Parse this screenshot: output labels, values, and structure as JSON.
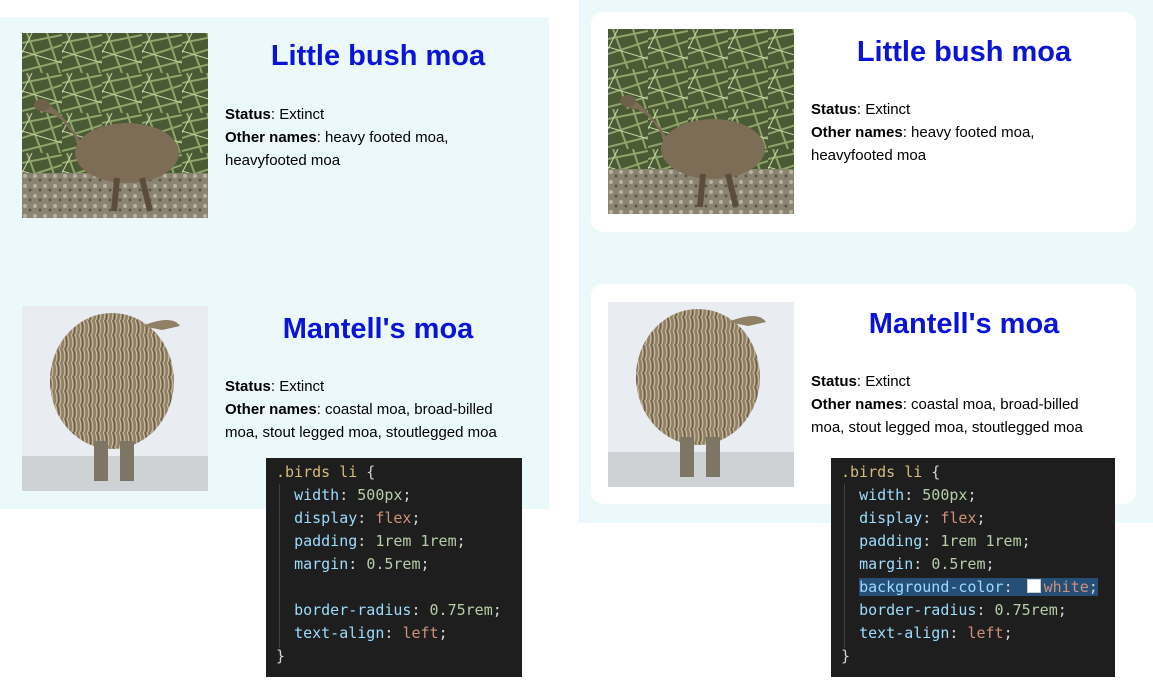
{
  "left": {
    "birds": [
      {
        "name": "Little bush moa",
        "status_label": "Status",
        "status": "Extinct",
        "other_label": "Other names",
        "other": "heavy footed moa, heavyfooted moa",
        "image": "little-bush-moa-illustration"
      },
      {
        "name": "Mantell's moa",
        "status_label": "Status",
        "status": "Extinct",
        "other_label": "Other names",
        "other": "coastal moa, broad-billed moa, stout legged moa, stoutlegged moa",
        "image": "mantells-moa-illustration"
      }
    ],
    "code": {
      "selector": ".birds li",
      "lines": [
        {
          "prop": "width",
          "value": "500px"
        },
        {
          "prop": "display",
          "value": "flex"
        },
        {
          "prop": "padding",
          "value": "1rem 1rem"
        },
        {
          "prop": "margin",
          "value": "0.5rem"
        },
        {
          "prop": "border-radius",
          "value": "0.75rem"
        },
        {
          "prop": "text-align",
          "value": "left"
        }
      ]
    }
  },
  "right": {
    "birds": [
      {
        "name": "Little bush moa",
        "status_label": "Status",
        "status": "Extinct",
        "other_label": "Other names",
        "other": "heavy footed moa, heavyfooted moa",
        "image": "little-bush-moa-illustration"
      },
      {
        "name": "Mantell's moa",
        "status_label": "Status",
        "status": "Extinct",
        "other_label": "Other names",
        "other": "coastal moa, broad-billed moa, stout legged moa, stoutlegged moa",
        "image": "mantells-moa-illustration"
      }
    ],
    "code": {
      "selector": ".birds li",
      "lines": [
        {
          "prop": "width",
          "value": "500px"
        },
        {
          "prop": "display",
          "value": "flex"
        },
        {
          "prop": "padding",
          "value": "1rem 1rem"
        },
        {
          "prop": "margin",
          "value": "0.5rem"
        },
        {
          "prop": "background-color",
          "value": "white",
          "highlighted": true
        },
        {
          "prop": "border-radius",
          "value": "0.75rem"
        },
        {
          "prop": "text-align",
          "value": "left"
        }
      ]
    }
  },
  "colors": {
    "panel_bg": "#ebf9fb",
    "title": "#0a14d6",
    "code_bg": "#1e1e1e",
    "highlight": "#264f78"
  }
}
